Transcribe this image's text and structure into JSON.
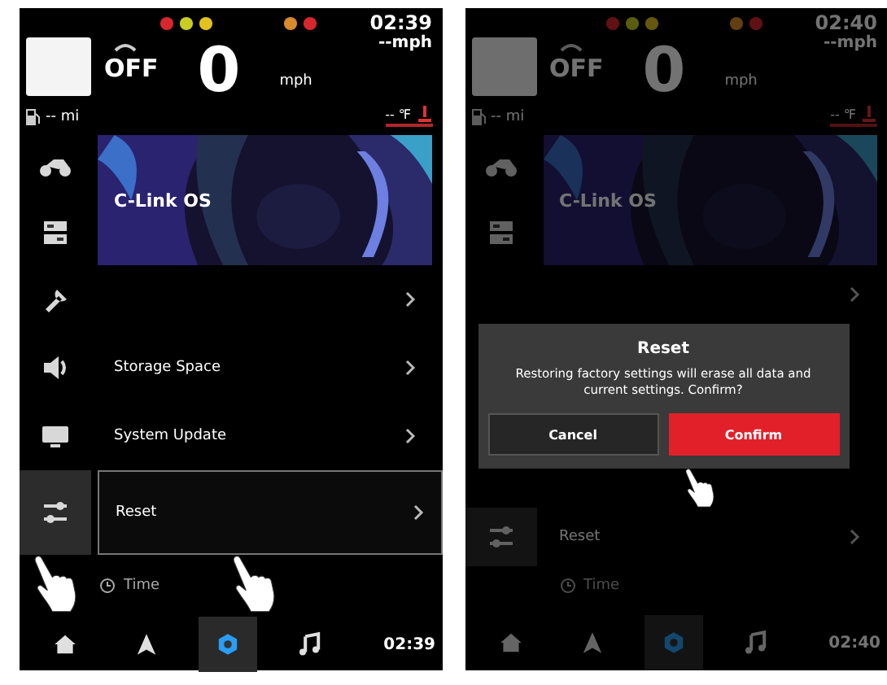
{
  "screens": [
    {
      "dimmed": false,
      "header": {
        "lights": [
          {
            "color": "#d8262f"
          },
          {
            "color": "#c9cc22"
          },
          {
            "color": "#e3c21f"
          },
          {
            "color": "#d98a2a"
          },
          {
            "color": "#d8262f"
          }
        ],
        "time": "02:39",
        "limit": "--mph",
        "gear": "OFF",
        "speed": "0",
        "unit": "mph",
        "range": "-- mi",
        "temperature": "-- ℉"
      },
      "sections": [
        {
          "kind": "banner",
          "title": "C-Link OS",
          "sidebar": [
            {
              "kind": "bike",
              "selected": false
            },
            {
              "kind": "panel",
              "selected": false
            }
          ]
        },
        {
          "kind": "item",
          "selected": false,
          "icon": {
            "kind": "wrench",
            "selected": false
          }
        },
        {
          "kind": "item",
          "label": "Storage Space",
          "selected": false,
          "icon": {
            "kind": "speaker",
            "selected": false
          }
        },
        {
          "kind": "item",
          "label": "System Update",
          "selected": false,
          "icon": {
            "kind": "monitor",
            "selected": false
          }
        },
        {
          "kind": "item",
          "label": "Reset",
          "selected": true,
          "icon": {
            "kind": "sliders",
            "selected": true
          }
        },
        {
          "kind": "group",
          "label": "Time"
        }
      ],
      "pointers": [
        {
          "kind": "sidebar_tab"
        },
        {
          "kind": "row"
        }
      ],
      "nav": {
        "items": [
          {
            "kind": "home",
            "selected": false
          },
          {
            "kind": "navigate",
            "selected": false
          },
          {
            "kind": "settings",
            "selected": true
          },
          {
            "kind": "music",
            "selected": false
          }
        ],
        "time": "02:39"
      }
    },
    {
      "dimmed": true,
      "header": {
        "lights": [
          {
            "color": "#611115"
          },
          {
            "color": "#5a5c0f"
          },
          {
            "color": "#66570e"
          },
          {
            "color": "#623e13"
          },
          {
            "color": "#611115"
          }
        ],
        "time": "02:40",
        "limit": "--mph",
        "gear": "OFF",
        "speed": "0",
        "unit": "mph",
        "range": "-- mi",
        "temperature": "-- ℉"
      },
      "sections": [
        {
          "kind": "banner",
          "title": "C-Link OS",
          "sidebar": [
            {
              "kind": "bike",
              "selected": false
            },
            {
              "kind": "panel",
              "selected": false
            }
          ]
        },
        {
          "kind": "item",
          "selected": false
        },
        {
          "kind": "dialog",
          "title": "Reset",
          "message": "Restoring factory settings will erase all data and current settings. Confirm?",
          "buttons": [
            {
              "label": "Cancel",
              "primary": false
            },
            {
              "label": "Confirm",
              "primary": true
            }
          ]
        },
        {
          "kind": "item",
          "label": "Reset",
          "selected": false,
          "icon": {
            "kind": "sliders",
            "selected": true
          }
        },
        {
          "kind": "group",
          "label": "Time"
        }
      ],
      "pointers": [
        {
          "kind": "confirm_button"
        }
      ],
      "nav": {
        "items": [
          {
            "kind": "home",
            "selected": false
          },
          {
            "kind": "navigate",
            "selected": false
          },
          {
            "kind": "settings",
            "selected": true
          },
          {
            "kind": "music",
            "selected": false
          }
        ],
        "time": "02:40"
      }
    }
  ]
}
